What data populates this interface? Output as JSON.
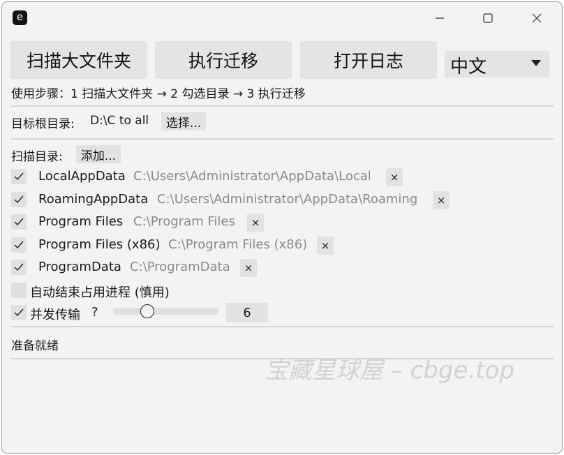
{
  "window": {
    "app_icon_letter": "e",
    "icons": {
      "minimize": "minimize-icon",
      "maximize": "maximize-icon",
      "close": "close-icon"
    }
  },
  "toolbar": {
    "scan_label": "扫描大文件夹",
    "migrate_label": "执行迁移",
    "open_log_label": "打开日志",
    "language_value": "中文"
  },
  "steps_text": "使用步骤：1 扫描大文件夹 → 2 勾选目录 → 3 执行迁移",
  "target": {
    "label": "目标根目录:",
    "value": "D:\\C to all",
    "choose_label": "选择..."
  },
  "scan_dirs": {
    "label": "扫描目录:",
    "add_label": "添加...",
    "remove_symbol": "×",
    "items": [
      {
        "checked": true,
        "name": "LocalAppData",
        "path": "C:\\Users\\Administrator\\AppData\\Local"
      },
      {
        "checked": true,
        "name": "RoamingAppData",
        "path": "C:\\Users\\Administrator\\AppData\\Roaming"
      },
      {
        "checked": true,
        "name": "Program Files",
        "path": "C:\\Program Files"
      },
      {
        "checked": true,
        "name": "Program Files (x86)",
        "path": "C:\\Program Files (x86)"
      },
      {
        "checked": true,
        "name": "ProgramData",
        "path": "C:\\ProgramData"
      }
    ]
  },
  "options": {
    "auto_kill_label": "自动结束占用进程 (慎用)",
    "auto_kill_checked": false,
    "concurrency_label": "并发传输",
    "concurrency_help": "?",
    "concurrency_checked": true,
    "concurrency_value": "6",
    "slider_fraction": 0.3
  },
  "status_text": "准备就绪",
  "watermark_text": "宝藏星球屋 – cbge.top"
}
